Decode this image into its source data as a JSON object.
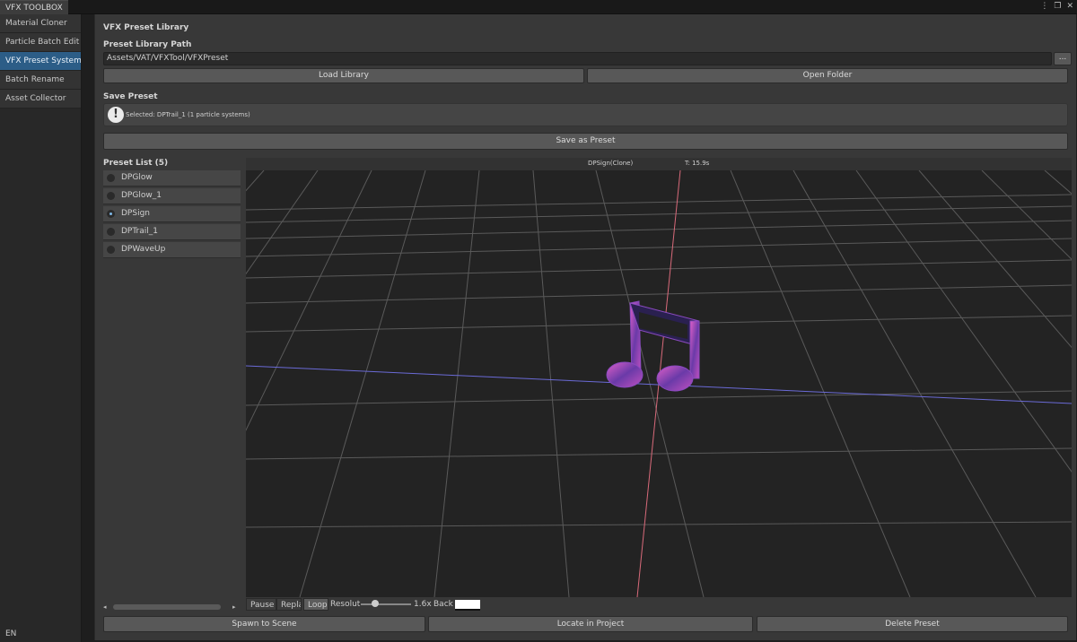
{
  "window": {
    "tab_title": "VFX TOOLBOX"
  },
  "title_icons": [
    "kebab-menu-icon",
    "maximize-icon",
    "close-icon"
  ],
  "sidebar": {
    "items": [
      {
        "label": "Material Cloner",
        "active": false
      },
      {
        "label": "Particle Batch Edit",
        "active": false
      },
      {
        "label": "VFX Preset System",
        "active": true
      },
      {
        "label": "Batch Rename",
        "active": false
      },
      {
        "label": "Asset Collector",
        "active": false
      }
    ],
    "language": "EN"
  },
  "main": {
    "section_title": "VFX Preset Library",
    "path_label": "Preset Library Path",
    "path_value": "Assets/VAT/VFXTool/VFXPreset",
    "browse_label": "...",
    "load_library_label": "Load Library",
    "open_folder_label": "Open Folder",
    "save_preset_heading": "Save Preset",
    "help_text": "Selected: DPTrail_1 (1 particle systems)",
    "save_as_preset_label": "Save as Preset",
    "preset_list_label": "Preset List (5)",
    "presets": [
      {
        "name": "DPGlow",
        "selected": false
      },
      {
        "name": "DPGlow_1",
        "selected": false
      },
      {
        "name": "DPSign",
        "selected": true
      },
      {
        "name": "DPTrail_1",
        "selected": false
      },
      {
        "name": "DPWaveUp",
        "selected": false
      }
    ],
    "preview": {
      "object_name": "DPSign(Clone)",
      "time": "T: 15.9s"
    },
    "controls": {
      "pause": "Pause",
      "replay": "Replay",
      "loop": "Loop",
      "resolution": "Resolut",
      "scale": "1.6x",
      "back": "Back",
      "background_color": "#ffffff"
    },
    "spawn_label": "Spawn to Scene",
    "locate_label": "Locate in Project",
    "delete_label": "Delete Preset"
  },
  "colors": {
    "accent": "#2c5d87",
    "axis_vertical": "#d86a7a",
    "axis_horizontal": "#6a6ad6",
    "grid": "#5a5a5a"
  }
}
